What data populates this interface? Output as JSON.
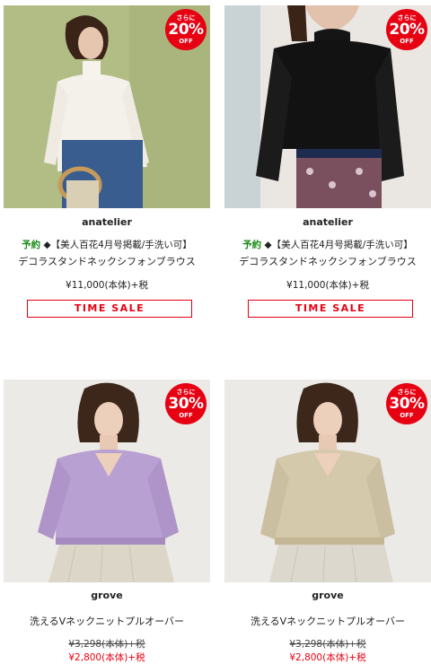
{
  "products": [
    {
      "badge": {
        "line1": "さらに",
        "percent": "20%",
        "line3": "OFF"
      },
      "brand": "anatelier",
      "reserve_label": "予約",
      "tagline": "◆【美人百花4月号掲載/手洗い可】",
      "title": "デコラスタンドネックシフォンブラウス",
      "price": "¥11,000(本体)+税",
      "time_sale": "TIME SALE"
    },
    {
      "badge": {
        "line1": "さらに",
        "percent": "20%",
        "line3": "OFF"
      },
      "brand": "anatelier",
      "reserve_label": "予約",
      "tagline": "◆【美人百花4月号掲載/手洗い可】",
      "title": "デコラスタンドネックシフォンブラウス",
      "price": "¥11,000(本体)+税",
      "time_sale": "TIME SALE"
    },
    {
      "badge": {
        "line1": "さらに",
        "percent": "30%",
        "line3": "OFF"
      },
      "brand": "grove",
      "title": "洗えるVネックニットプルオーバー",
      "old_price": "¥3,298(本体)+税",
      "sale_price": "¥2,800(本体)+税"
    },
    {
      "badge": {
        "line1": "さらに",
        "percent": "30%",
        "line3": "OFF"
      },
      "brand": "grove",
      "title": "洗えるVネックニットプルオーバー",
      "old_price": "¥3,298(本体)+税",
      "sale_price": "¥2,800(本体)+税"
    }
  ],
  "colors": {
    "accent_red": "#e60012",
    "reserve_green": "#1a8a1a"
  }
}
